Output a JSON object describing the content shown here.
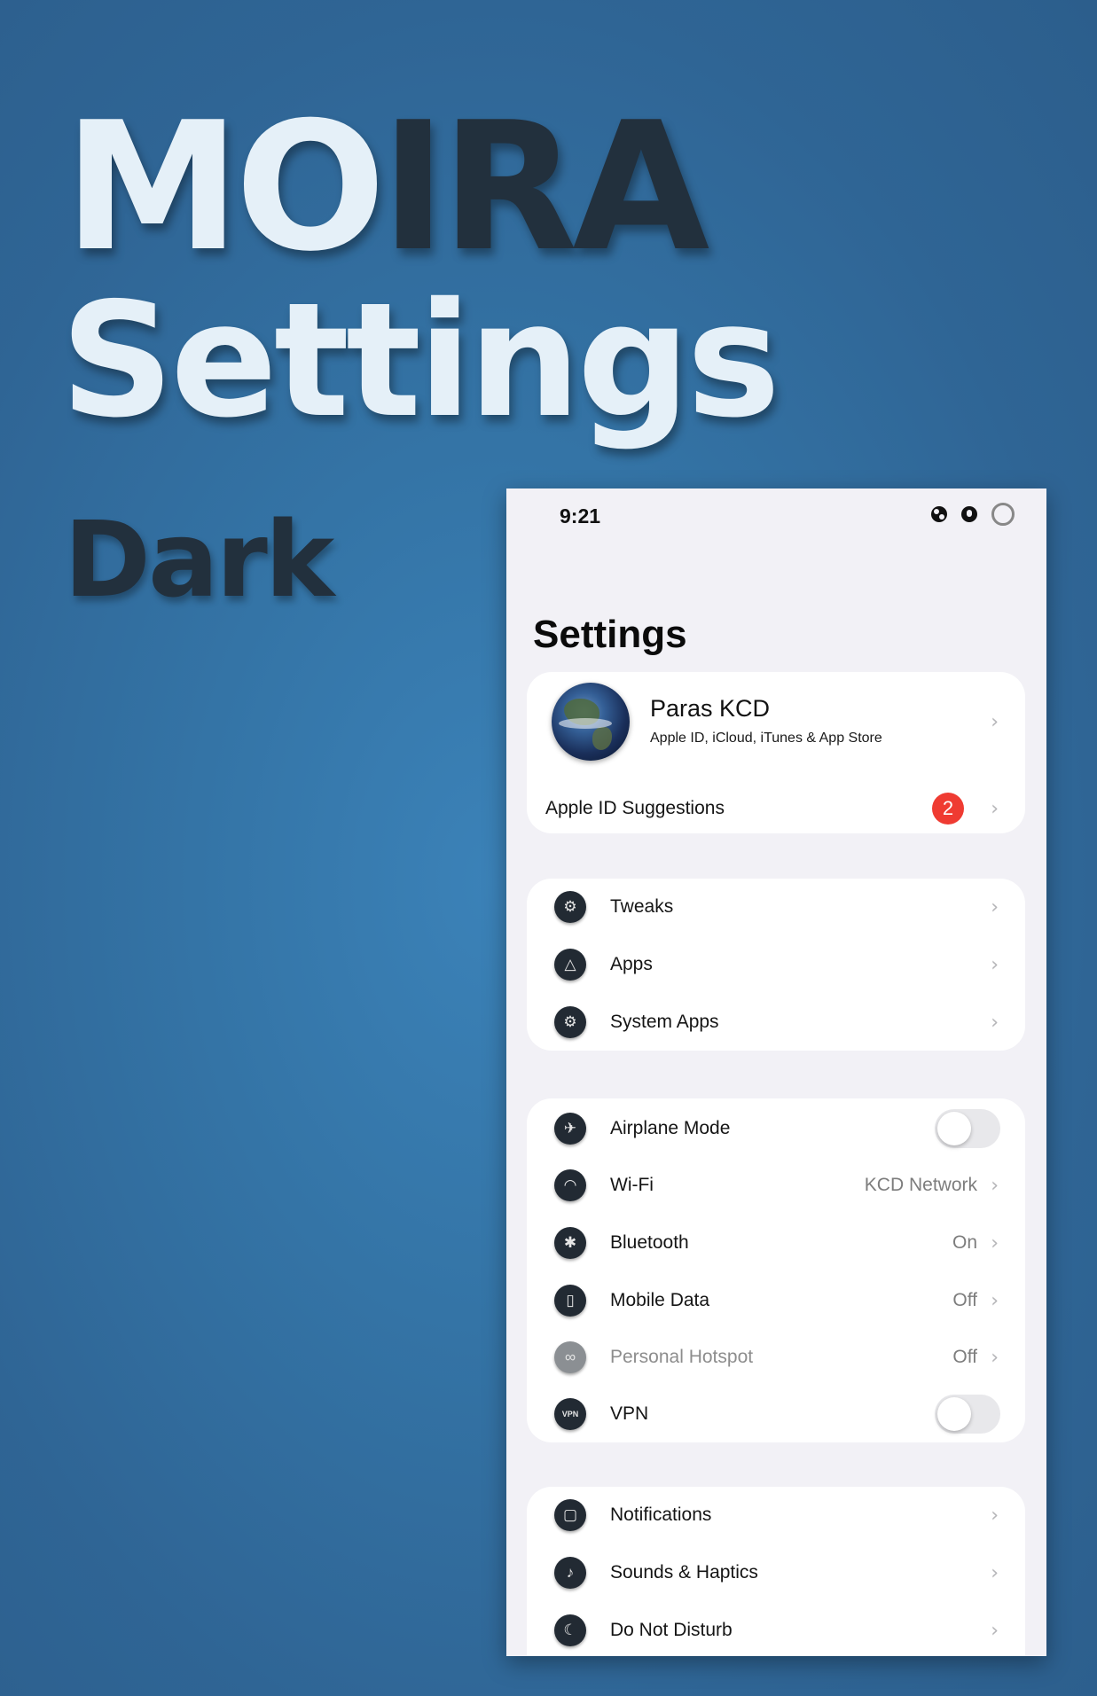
{
  "hero": {
    "title_light": "MO",
    "title_dark": "IRA",
    "subtitle": "Settings",
    "variant": "Dark"
  },
  "status_bar": {
    "time": "9:21"
  },
  "page_title": "Settings",
  "profile": {
    "name": "Paras KCD",
    "subtitle": "Apple ID, iCloud, iTunes & App Store",
    "suggestions_label": "Apple ID Suggestions",
    "suggestions_badge": "2"
  },
  "group1": [
    {
      "label": "Tweaks",
      "icon": "tweaks-icon"
    },
    {
      "label": "Apps",
      "icon": "app-store-icon"
    },
    {
      "label": "System Apps",
      "icon": "gear-icon"
    }
  ],
  "group2": [
    {
      "label": "Airplane Mode",
      "icon": "airplane-icon",
      "toggle": false
    },
    {
      "label": "Wi-Fi",
      "icon": "wifi-icon",
      "value": "KCD Network"
    },
    {
      "label": "Bluetooth",
      "icon": "bluetooth-icon",
      "value": "On"
    },
    {
      "label": "Mobile Data",
      "icon": "mobile-data-icon",
      "value": "Off"
    },
    {
      "label": "Personal Hotspot",
      "icon": "hotspot-icon",
      "value": "Off"
    },
    {
      "label": "VPN",
      "icon": "vpn-icon",
      "toggle": false,
      "icon_text": "VPN"
    }
  ],
  "group3": [
    {
      "label": "Notifications",
      "icon": "notifications-icon"
    },
    {
      "label": "Sounds & Haptics",
      "icon": "speaker-icon"
    },
    {
      "label": "Do Not Disturb",
      "icon": "moon-icon"
    }
  ],
  "colors": {
    "badge": "#ef3b32",
    "icon_bg": "#222a33",
    "hero_light": "#e5f0f8",
    "hero_dark": "#22303d"
  }
}
